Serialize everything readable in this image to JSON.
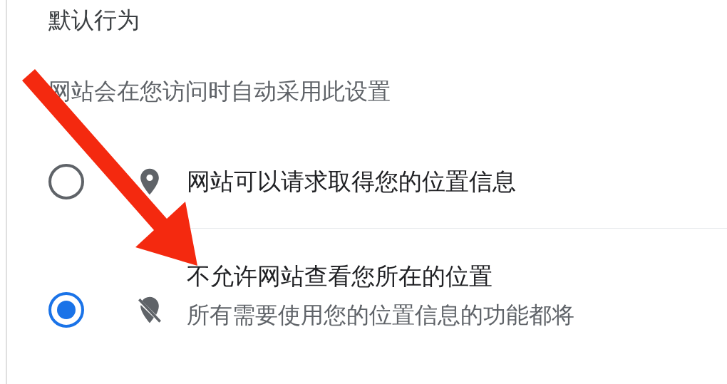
{
  "section": {
    "title": "默认行为",
    "description": "网站会在您访问时自动采用此设置"
  },
  "options": [
    {
      "kind": "allow",
      "label": "网站可以请求取得您的位置信息",
      "selected": false
    },
    {
      "kind": "block",
      "label": "不允许网站查看您所在的位置",
      "sublabel": "所有需要使用您的位置信息的功能都将",
      "selected": true
    }
  ]
}
